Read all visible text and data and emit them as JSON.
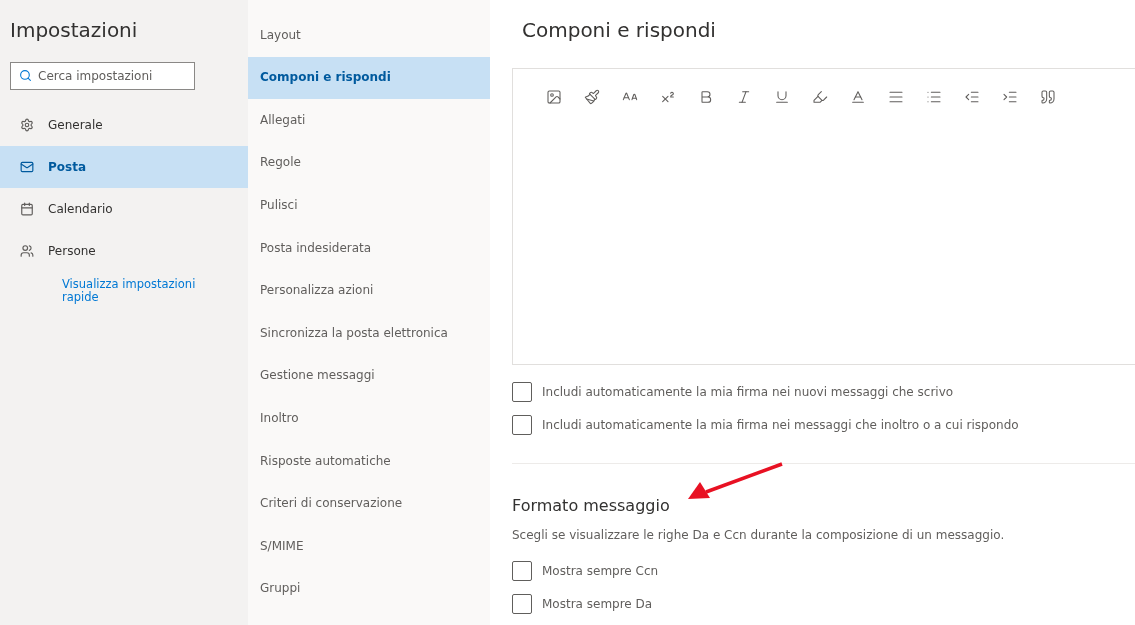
{
  "sidebar": {
    "title": "Impostazioni",
    "search": {
      "placeholder": "Cerca impostazioni"
    },
    "items": [
      {
        "label": "Generale",
        "selected": false
      },
      {
        "label": "Posta",
        "selected": true
      },
      {
        "label": "Calendario",
        "selected": false
      },
      {
        "label": "Persone",
        "selected": false
      }
    ],
    "link": "Visualizza impostazioni rapide"
  },
  "submenu": {
    "items": [
      {
        "label": "Layout",
        "selected": false
      },
      {
        "label": "Componi e rispondi",
        "selected": true
      },
      {
        "label": "Allegati",
        "selected": false
      },
      {
        "label": "Regole",
        "selected": false
      },
      {
        "label": "Pulisci",
        "selected": false
      },
      {
        "label": "Posta indesiderata",
        "selected": false
      },
      {
        "label": "Personalizza azioni",
        "selected": false
      },
      {
        "label": "Sincronizza la posta elettronica",
        "selected": false
      },
      {
        "label": "Gestione messaggi",
        "selected": false
      },
      {
        "label": "Inoltro",
        "selected": false
      },
      {
        "label": "Risposte automatiche",
        "selected": false
      },
      {
        "label": "Criteri di conservazione",
        "selected": false
      },
      {
        "label": "S/MIME",
        "selected": false
      },
      {
        "label": "Gruppi",
        "selected": false
      }
    ]
  },
  "content": {
    "title": "Componi e rispondi",
    "toolbar": [
      {
        "kind": "image"
      },
      {
        "kind": "format-painter"
      },
      {
        "kind": "font-size"
      },
      {
        "kind": "superscript"
      },
      {
        "kind": "bold"
      },
      {
        "kind": "italic"
      },
      {
        "kind": "underline"
      },
      {
        "kind": "highlight"
      },
      {
        "kind": "font-color"
      },
      {
        "kind": "align"
      },
      {
        "kind": "list"
      },
      {
        "kind": "outdent"
      },
      {
        "kind": "indent"
      },
      {
        "kind": "quote"
      }
    ],
    "signature_options": [
      {
        "label": "Includi automaticamente la mia firma nei nuovi messaggi che scrivo",
        "checked": false
      },
      {
        "label": "Includi automaticamente la mia firma nei messaggi che inoltro o a cui rispondo",
        "checked": false
      }
    ],
    "format": {
      "title": "Formato messaggio",
      "description": "Scegli se visualizzare le righe Da e Ccn durante la composizione di un messaggio.",
      "options": [
        {
          "label": "Mostra sempre Ccn",
          "checked": false
        },
        {
          "label": "Mostra sempre Da",
          "checked": false
        }
      ]
    }
  }
}
